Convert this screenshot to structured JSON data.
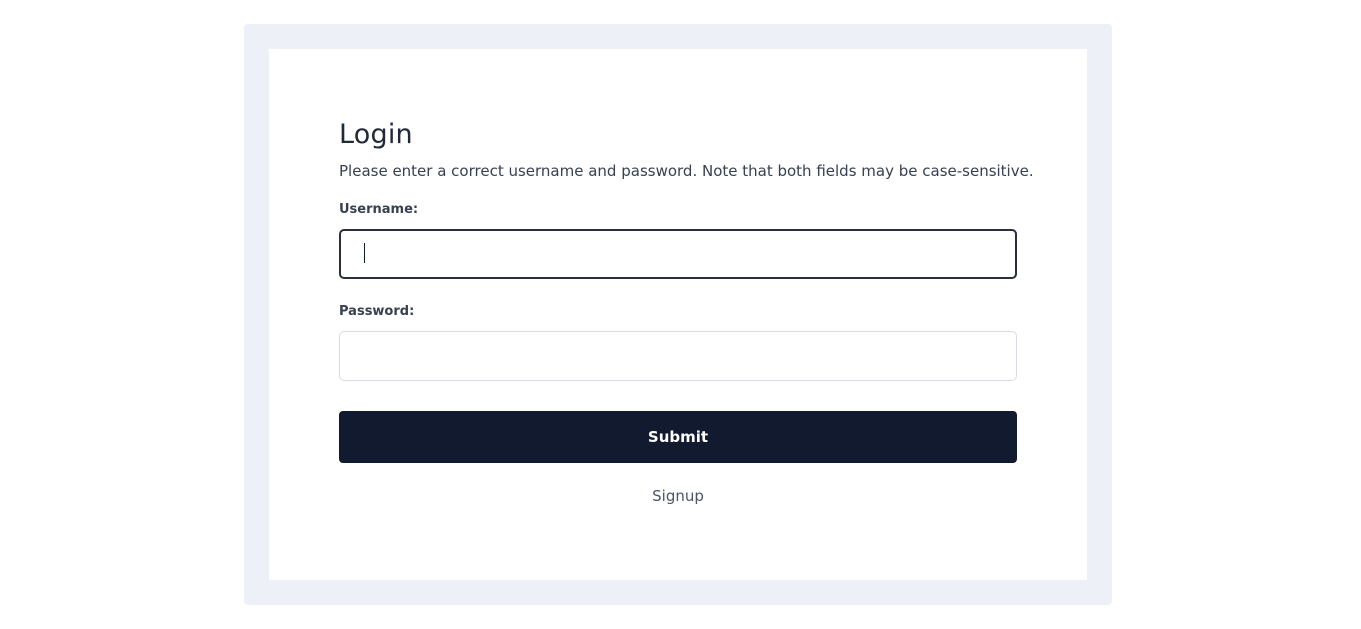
{
  "login": {
    "title": "Login",
    "description": "Please enter a correct username and password. Note that both fields may be case-sensitive.",
    "username_label": "Username:",
    "username_value": "",
    "password_label": "Password:",
    "password_value": "",
    "submit_label": "Submit",
    "signup_label": "Signup"
  },
  "colors": {
    "page_background": "#ffffff",
    "frame_background": "#eef0f8",
    "submit_background": "#121a2f",
    "submit_text": "#ffffff"
  }
}
